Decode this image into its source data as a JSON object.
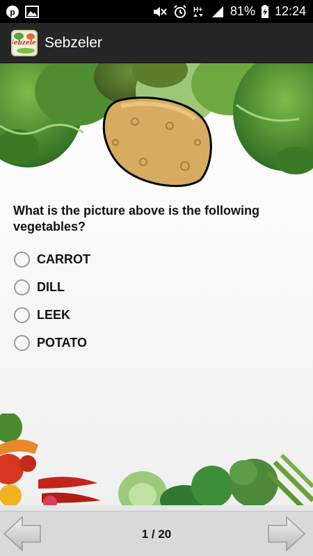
{
  "status_bar": {
    "left_icons": [
      "p-badge-icon",
      "image-icon"
    ],
    "right_icons": [
      "mute-icon",
      "alarm-icon",
      "hplus-icon",
      "signal-icon"
    ],
    "battery": "81%",
    "time": "12:24"
  },
  "action_bar": {
    "logo_text": "Sebzeler",
    "title": "Sebzeler"
  },
  "quiz": {
    "image": "potato-illustration",
    "question": "What is the picture above is the following vegetables?",
    "options": [
      {
        "label": "CARROT",
        "selected": false
      },
      {
        "label": "DILL",
        "selected": false
      },
      {
        "label": "LEEK",
        "selected": false
      },
      {
        "label": "POTATO",
        "selected": false
      }
    ]
  },
  "navigation": {
    "prev_icon": "arrow-left-icon",
    "next_icon": "arrow-right-icon",
    "counter": "1 / 20"
  },
  "colors": {
    "status_bar": "#000000",
    "action_bar": "#262626",
    "bottom_bar": "#d9d9d9",
    "potato": "#d7ac60"
  }
}
